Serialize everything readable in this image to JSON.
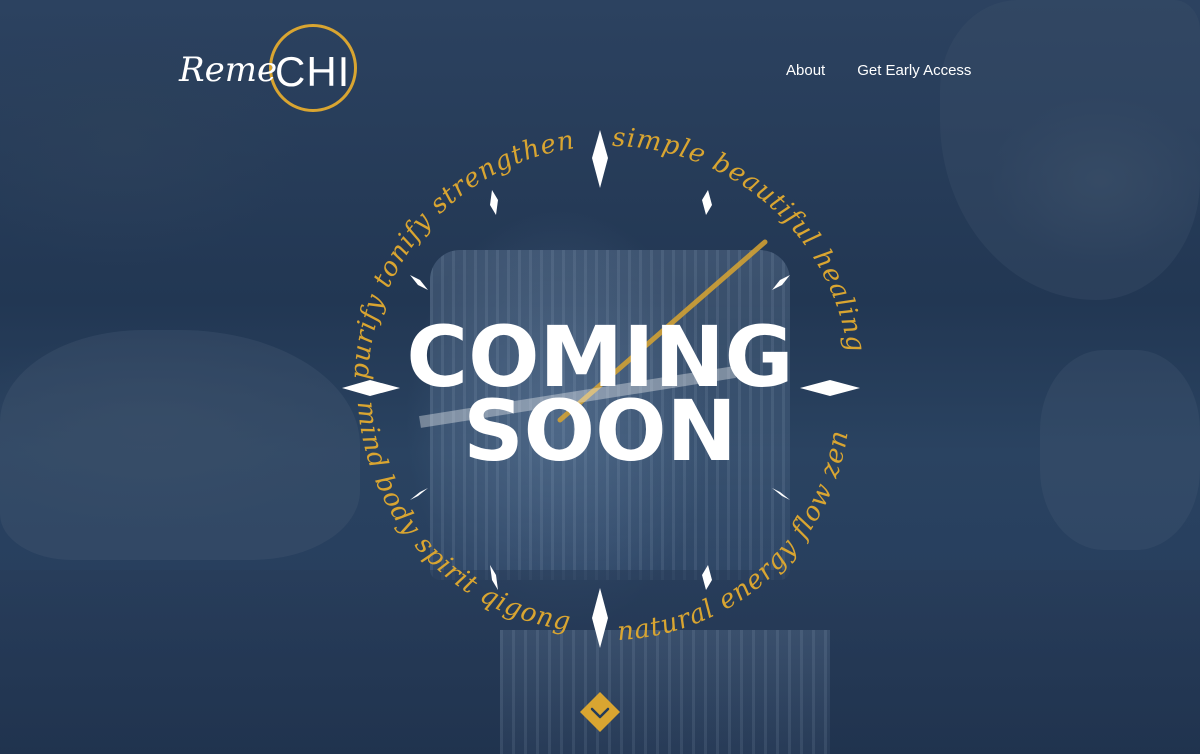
{
  "brand": {
    "script": "Reme",
    "caps": "CHI"
  },
  "nav": {
    "items": [
      {
        "label": "About"
      },
      {
        "label": "Get Early Access"
      }
    ]
  },
  "hero": {
    "line1": "COMING",
    "line2": "SOON",
    "ring_top": "purify tonify strengthen",
    "ring_right": "simple beautiful healing",
    "ring_bottom_left": "mind body spirit qigong",
    "ring_bottom_right": "natural energy flow zen"
  },
  "colors": {
    "gold": "#d9a531",
    "white": "#ffffff",
    "overlay": "#233a5a"
  },
  "icons": {
    "scroll": "chevron-down-icon",
    "ticks": "compass-marker-icon"
  }
}
